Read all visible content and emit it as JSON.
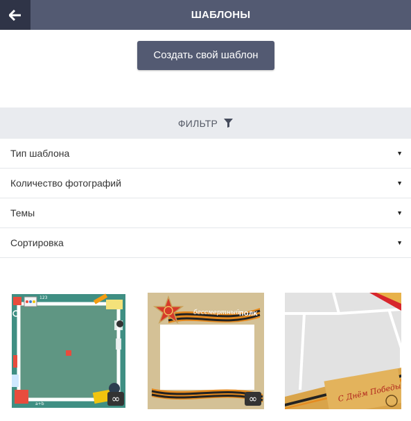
{
  "header": {
    "title": "ШАБЛОНЫ",
    "back_icon": "arrow-left-icon"
  },
  "actions": {
    "create_label": "Создать свой шаблон"
  },
  "filter": {
    "label": "ФИЛЬТР",
    "icon": "funnel-icon",
    "rows": [
      {
        "label": "Тип шаблона",
        "caret": "▼"
      },
      {
        "label": "Количество фотографий",
        "caret": "▼"
      },
      {
        "label": "Темы",
        "caret": "▼"
      },
      {
        "label": "Сортировка",
        "caret": "▼"
      }
    ]
  },
  "templates": [
    {
      "name": "school-frame",
      "badge": "∞",
      "text_items": [
        "123",
        "a+b"
      ]
    },
    {
      "name": "immortal-regiment-frame",
      "badge": "∞",
      "text_items": [
        "бессмертный",
        "ПОЛК"
      ]
    },
    {
      "name": "victory-day-frame",
      "text_items": [
        "С Днём Победы!"
      ]
    }
  ],
  "colors": {
    "header_bg": "#535a72",
    "back_bg": "#2f3447",
    "filter_bg": "#e9ebef"
  }
}
